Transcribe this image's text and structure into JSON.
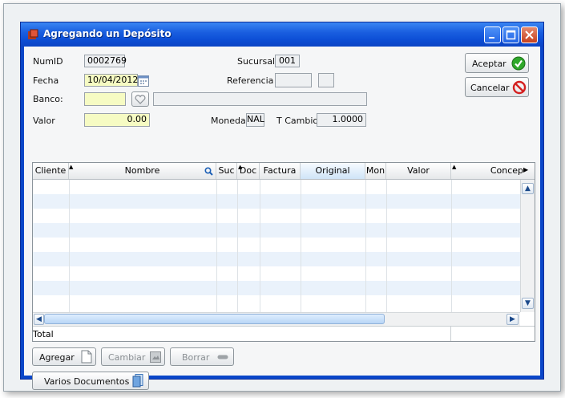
{
  "window": {
    "title": "Agregando un Depósito",
    "controls": {
      "minimize": "minimize-icon",
      "maximize": "maximize-icon",
      "close": "close-icon"
    }
  },
  "form": {
    "numid_label": "NumID",
    "numid_value": "0002769",
    "sucursal_label": "Sucursal",
    "sucursal_value": "001",
    "fecha_label": "Fecha",
    "fecha_value": "10/04/2012",
    "referencia_label": "Referencia",
    "referencia_value": "",
    "referencia_value2": "",
    "banco_label": "Banco:",
    "banco_value": "",
    "banco_desc": "",
    "valor_label": "Valor",
    "valor_value": "0.00",
    "moneda_label": "Moneda",
    "moneda_value": "NAL",
    "tcambio_label": "T Cambio",
    "tcambio_value": "1.0000"
  },
  "actions": {
    "aceptar": "Aceptar",
    "cancelar": "Cancelar"
  },
  "grid": {
    "columns": [
      "Cliente",
      "Nombre",
      "Suc",
      "Doc",
      "Factura",
      "Original",
      "Mon",
      "Valor",
      "Concep"
    ],
    "total_label": "Total"
  },
  "bottom_buttons": {
    "agregar": "Agregar",
    "cambiar": "Cambiar",
    "borrar": "Borrar",
    "varios": "Varios Documentos"
  },
  "colors": {
    "title_bar": "#0b44c4",
    "yellow_field": "#f6fbc3",
    "row_alt": "#eaf2fb",
    "accept_green": "#2fa82a",
    "cancel_red": "#d42020"
  }
}
